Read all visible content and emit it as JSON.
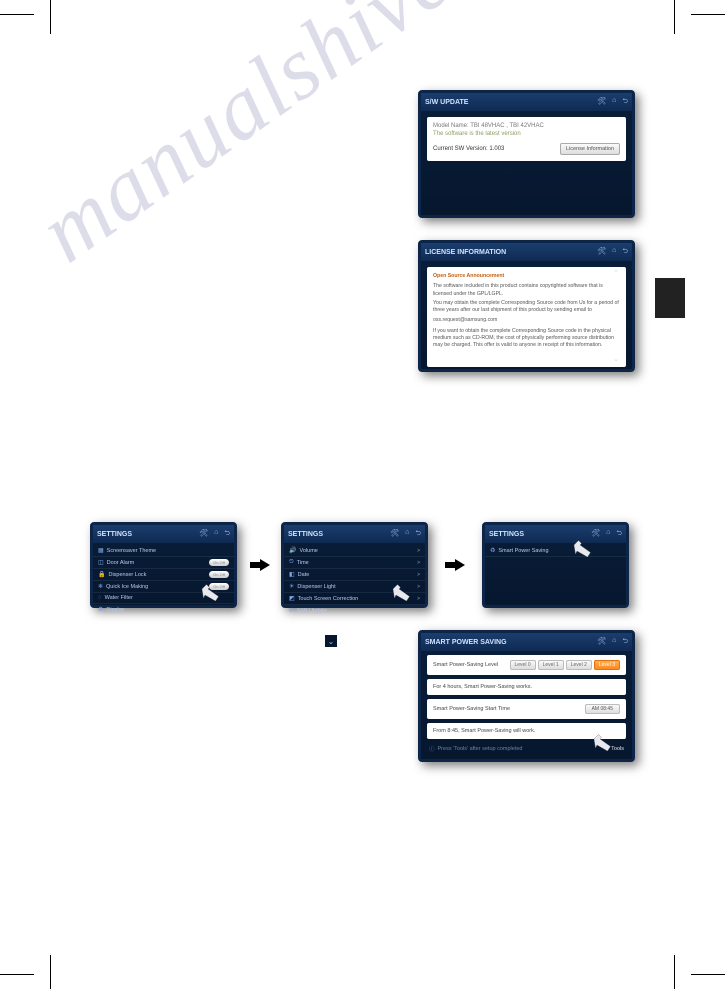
{
  "watermark": "manualshive.com",
  "sw_update": {
    "title": "S/W UPDATE",
    "model": "Model Name: TBI 48VHAC , TBI 42VHAC",
    "latest": "The software is the latest version",
    "current_label": "Current SW Version: 1.003",
    "license_btn": "License Information"
  },
  "license": {
    "title": "LICENSE INFORMATION",
    "osa": "Open Source Announcement",
    "p1": "The software included in this product contains copyrighted software that is licensed under the GPL/LGPL.",
    "p2": "You may obtain the complete Corresponding Source code from Us for a period of three years after our last shipment of this product by sending email to",
    "email": "oss.request@samsung.com",
    "p3": "If you want to obtain the complete Corresponding Source code in the physical medium such as CD-ROM, the cost of physically performing source distribution may be charged. This offer is valid to anyone in receipt of this information."
  },
  "settings_title": "SETTINGS",
  "settings1": {
    "items": [
      {
        "icon": "▦",
        "label": "Screensaver Theme"
      },
      {
        "icon": "◫",
        "label": "Door Alarm",
        "toggle": "On Off"
      },
      {
        "icon": "🔒",
        "label": "Dispenser Lock",
        "toggle": "On Off"
      },
      {
        "icon": "❄",
        "label": "Quick Ice Making",
        "toggle": "On Off"
      },
      {
        "icon": "◌",
        "label": "Water Filter"
      },
      {
        "icon": "⚙",
        "label": "Display"
      }
    ]
  },
  "settings2": {
    "items": [
      {
        "icon": "🔊",
        "label": "Volume"
      },
      {
        "icon": "⏲",
        "label": "Time"
      },
      {
        "icon": "◧",
        "label": "Date"
      },
      {
        "icon": "☀",
        "label": "Dispenser Light"
      },
      {
        "icon": "◩",
        "label": "Touch Screen Correction"
      },
      {
        "icon": "⟳",
        "label": "S/W Update"
      }
    ]
  },
  "settings3": {
    "item": {
      "icon": "♻",
      "label": "Smart Power Saving"
    }
  },
  "smart": {
    "title": "SMART POWER SAVING",
    "row1_label": "Smart Power-Saving Level",
    "levels": [
      "Level 0",
      "Level 1",
      "Level 2",
      "Level 3"
    ],
    "row2": "For 4 hours, Smart Power-Saving works.",
    "row3_label": "Smart Power-Saving Start Time",
    "row3_time": "AM 08:45",
    "row4": "From 8:45, Smart Power-Saving will work.",
    "footer": "Press 'Tools' after setup completed",
    "tools": "Tools"
  }
}
